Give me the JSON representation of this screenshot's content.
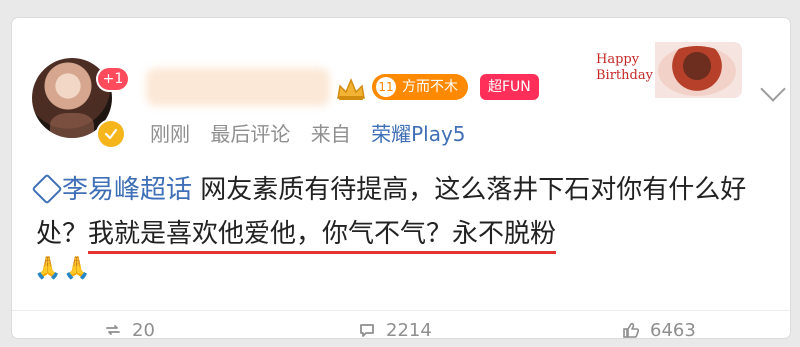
{
  "user": {
    "name": ""
  },
  "badges": {
    "plus": "+1",
    "level_number": "11",
    "level_text": "方而不木",
    "fun": "超FUN"
  },
  "meta": {
    "time": "刚刚",
    "latest": "最后评论",
    "from_label": "来自",
    "device": "荣耀Play5"
  },
  "decor": {
    "birthday_line1": "Happy",
    "birthday_line2": "Birthday"
  },
  "post": {
    "topic": "李易峰超话",
    "text_before": " 网友素质有待提高，这么落井下石对你有什么好处？",
    "text_highlight": "我就是喜欢他爱他，你气不气？永不脱粉",
    "emojis": "🙏🙏"
  },
  "actions": {
    "repost": "20",
    "comments": "2214",
    "likes": "6463"
  },
  "icons": {
    "more": "chevron-down-icon",
    "verified": "verified-icon",
    "crown": "crown-icon",
    "repost": "repost-icon",
    "comment": "comment-icon",
    "like": "like-icon"
  }
}
